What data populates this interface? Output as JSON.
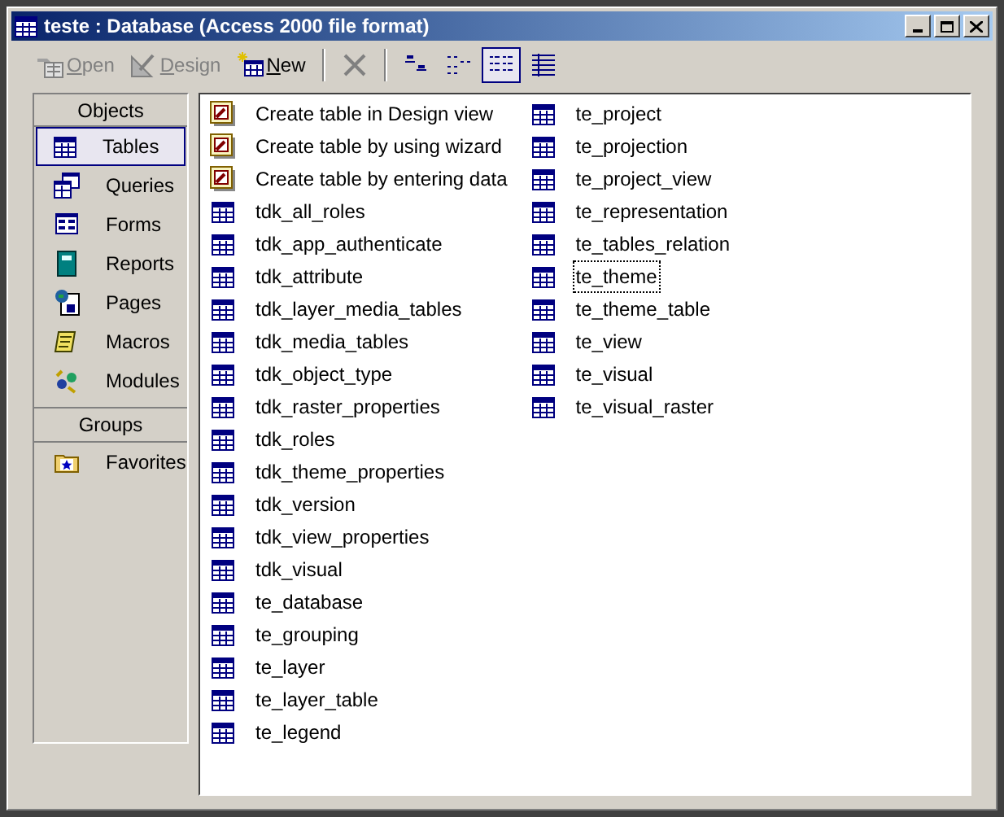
{
  "window": {
    "title": "teste : Database (Access 2000 file format)"
  },
  "toolbar": [
    {
      "kind": "open",
      "label": "Open",
      "disabled": true
    },
    {
      "kind": "design",
      "label": "Design",
      "disabled": true
    },
    {
      "kind": "new",
      "label": "New",
      "disabled": false
    },
    {
      "kind": "delete",
      "disabled": true
    },
    {
      "kind": "large-icons",
      "selected": false
    },
    {
      "kind": "small-icons",
      "selected": false
    },
    {
      "kind": "list",
      "selected": true
    },
    {
      "kind": "details",
      "selected": false
    }
  ],
  "sidebar": {
    "objects_header": "Objects",
    "objects": [
      {
        "kind": "tables",
        "label": "Tables",
        "selected": true
      },
      {
        "kind": "queries",
        "label": "Queries",
        "selected": false
      },
      {
        "kind": "forms",
        "label": "Forms",
        "selected": false
      },
      {
        "kind": "reports",
        "label": "Reports",
        "selected": false
      },
      {
        "kind": "pages",
        "label": "Pages",
        "selected": false
      },
      {
        "kind": "macros",
        "label": "Macros",
        "selected": false
      },
      {
        "kind": "modules",
        "label": "Modules",
        "selected": false
      }
    ],
    "groups_header": "Groups",
    "groups": [
      {
        "kind": "favorites",
        "label": "Favorites",
        "selected": false
      }
    ]
  },
  "items": [
    {
      "kind": "shortcut",
      "label": "Create table in Design view",
      "focused": false
    },
    {
      "kind": "shortcut",
      "label": "Create table by using wizard",
      "focused": false
    },
    {
      "kind": "shortcut",
      "label": "Create table by entering data",
      "focused": false
    },
    {
      "kind": "table",
      "label": "tdk_all_roles",
      "focused": false
    },
    {
      "kind": "table",
      "label": "tdk_app_authenticate",
      "focused": false
    },
    {
      "kind": "table",
      "label": "tdk_attribute",
      "focused": false
    },
    {
      "kind": "table",
      "label": "tdk_layer_media_tables",
      "focused": false
    },
    {
      "kind": "table",
      "label": "tdk_media_tables",
      "focused": false
    },
    {
      "kind": "table",
      "label": "tdk_object_type",
      "focused": false
    },
    {
      "kind": "table",
      "label": "tdk_raster_properties",
      "focused": false
    },
    {
      "kind": "table",
      "label": "tdk_roles",
      "focused": false
    },
    {
      "kind": "table",
      "label": "tdk_theme_properties",
      "focused": false
    },
    {
      "kind": "table",
      "label": "tdk_version",
      "focused": false
    },
    {
      "kind": "table",
      "label": "tdk_view_properties",
      "focused": false
    },
    {
      "kind": "table",
      "label": "tdk_visual",
      "focused": false
    },
    {
      "kind": "table",
      "label": "te_database",
      "focused": false
    },
    {
      "kind": "table",
      "label": "te_grouping",
      "focused": false
    },
    {
      "kind": "table",
      "label": "te_layer",
      "focused": false
    },
    {
      "kind": "table",
      "label": "te_layer_table",
      "focused": false
    },
    {
      "kind": "table",
      "label": "te_legend",
      "focused": false
    },
    {
      "kind": "table",
      "label": "te_project",
      "focused": false
    },
    {
      "kind": "table",
      "label": "te_projection",
      "focused": false
    },
    {
      "kind": "table",
      "label": "te_project_view",
      "focused": false
    },
    {
      "kind": "table",
      "label": "te_representation",
      "focused": false
    },
    {
      "kind": "table",
      "label": "te_tables_relation",
      "focused": false
    },
    {
      "kind": "table",
      "label": "te_theme",
      "focused": true
    },
    {
      "kind": "table",
      "label": "te_theme_table",
      "focused": false
    },
    {
      "kind": "table",
      "label": "te_view",
      "focused": false
    },
    {
      "kind": "table",
      "label": "te_visual",
      "focused": false
    },
    {
      "kind": "table",
      "label": "te_visual_raster",
      "focused": false
    }
  ]
}
